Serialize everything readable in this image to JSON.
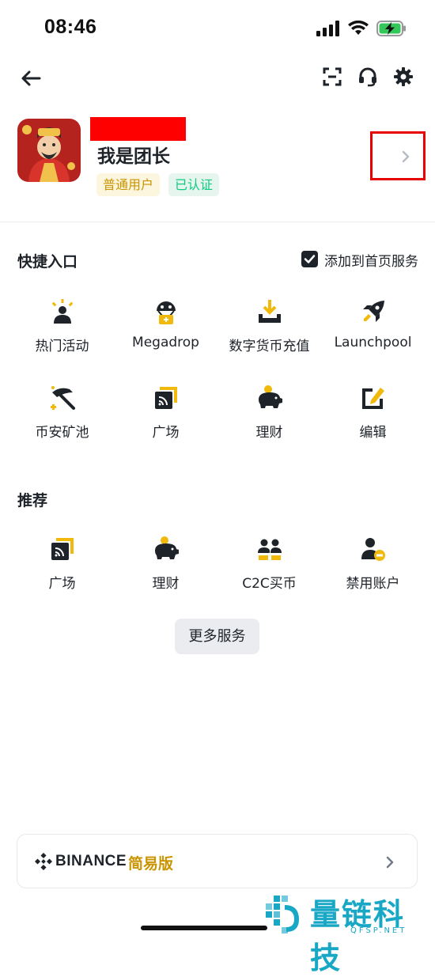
{
  "status_bar": {
    "time": "08:46"
  },
  "profile": {
    "nickname": "我是团长",
    "badge_normal": "普通用户",
    "badge_verified": "已认证"
  },
  "quick_access": {
    "title": "快捷入口",
    "add_to_home_label": "添加到首页服务",
    "add_to_home_checked": true,
    "items": [
      {
        "label": "热门活动",
        "icon": "hot-activity-icon"
      },
      {
        "label": "Megadrop",
        "icon": "megadrop-icon"
      },
      {
        "label": "数字货币充值",
        "icon": "deposit-icon"
      },
      {
        "label": "Launchpool",
        "icon": "rocket-icon"
      },
      {
        "label": "币安矿池",
        "icon": "pickaxe-icon"
      },
      {
        "label": "广场",
        "icon": "square-feed-icon"
      },
      {
        "label": "理财",
        "icon": "piggy-bank-icon"
      },
      {
        "label": "编辑",
        "icon": "edit-icon"
      }
    ]
  },
  "recommend": {
    "title": "推荐",
    "items": [
      {
        "label": "广场",
        "icon": "square-feed-icon"
      },
      {
        "label": "理财",
        "icon": "piggy-bank-icon"
      },
      {
        "label": "C2C买币",
        "icon": "c2c-users-icon"
      },
      {
        "label": "禁用账户",
        "icon": "disable-user-icon"
      }
    ]
  },
  "more_services_label": "更多服务",
  "lite": {
    "brand": "BINANCE",
    "label": "简易版"
  },
  "watermark": {
    "title": "量链科技",
    "sub": "QFSP.NET"
  },
  "colors": {
    "accent": "#F0B90B",
    "dark": "#1E2329",
    "verified": "#0ECB81",
    "watermark": "#19A7C6"
  }
}
